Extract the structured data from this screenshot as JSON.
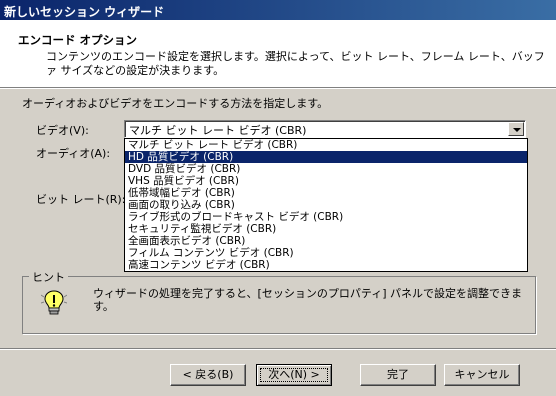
{
  "window": {
    "title": "新しいセッション ウィザード"
  },
  "header": {
    "title": "エンコード オプション",
    "description": "コンテンツのエンコード設定を選択します。選択によって、ビット レート、フレーム レート、バッファ サイズなどの設定が決まります。"
  },
  "main": {
    "instruction": "オーディオおよびビデオをエンコードする方法を指定します。",
    "video_label": "ビデオ(V):",
    "audio_label": "オーディオ(A):",
    "bitrate_label": "ビット レート(R):",
    "video_selected": "マルチ ビット レート ビデオ (CBR)"
  },
  "dropdown": {
    "items": [
      "マルチ ビット レート ビデオ (CBR)",
      "HD 品質ビデオ (CBR)",
      "DVD 品質ビデオ (CBR)",
      "VHS 品質ビデオ (CBR)",
      "低帯域幅ビデオ (CBR)",
      "画面の取り込み (CBR)",
      "ライブ形式のブロードキャスト ビデオ (CBR)",
      "セキュリティ監視ビデオ (CBR)",
      "全画面表示ビデオ (CBR)",
      "フィルム コンテンツ ビデオ (CBR)",
      "高速コンテンツ ビデオ (CBR)"
    ],
    "highlighted": "HD 品質ビデオ (CBR)"
  },
  "hint": {
    "legend": "ヒント",
    "text": "ウィザードの処理を完了すると、[セッションのプロパティ] パネルで設定を調整できます。",
    "icon": "lightbulb-icon"
  },
  "buttons": {
    "back": "< 戻る(B)",
    "next": "次へ(N) >",
    "finish": "完了",
    "cancel": "キャンセル"
  },
  "colors": {
    "titlebar": "#0a246a",
    "selection": "#0a246a",
    "face": "#d4d0c8"
  }
}
